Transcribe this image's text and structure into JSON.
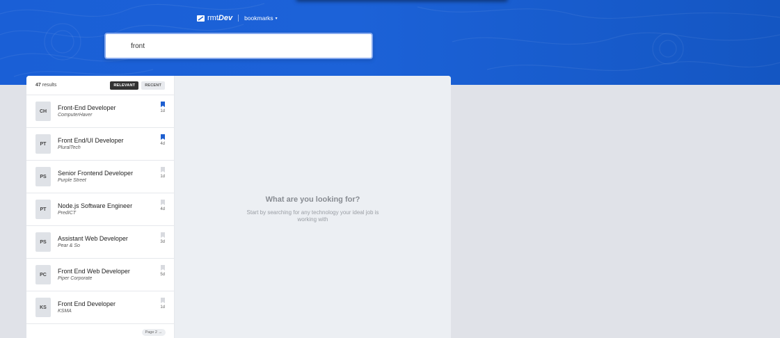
{
  "header": {
    "logo_light": "rmt",
    "logo_bold": "Dev",
    "bookmarks_label": "bookmarks",
    "bookmarks_caret": "▾"
  },
  "search": {
    "value": "front",
    "placeholder": ""
  },
  "sidebar": {
    "results_count": "47",
    "results_suffix": " results",
    "sort": [
      {
        "label": "RELEVANT",
        "active": true
      },
      {
        "label": "RECENT",
        "active": false
      }
    ],
    "jobs": [
      {
        "badge": "CH",
        "title": "Front-End Developer",
        "company": "ComputerHaver",
        "age": "1d",
        "bookmarked": true
      },
      {
        "badge": "PT",
        "title": "Front End/UI Developer",
        "company": "PluralTech",
        "age": "4d",
        "bookmarked": true
      },
      {
        "badge": "PS",
        "title": "Senior Frontend Developer",
        "company": "Purple Street",
        "age": "1d",
        "bookmarked": false
      },
      {
        "badge": "PT",
        "title": "Node.js Software Engineer",
        "company": "PredICT",
        "age": "4d",
        "bookmarked": false
      },
      {
        "badge": "PS",
        "title": "Assistant Web Developer",
        "company": "Pear & So",
        "age": "3d",
        "bookmarks": false
      },
      {
        "badge": "PC",
        "title": "Front End Web Developer",
        "company": "Piper Corporate",
        "age": "5d",
        "bookmarked": false
      },
      {
        "badge": "KS",
        "title": "Front End Developer",
        "company": "KSMA",
        "age": "1d",
        "bookmarked": false
      }
    ],
    "page_label": "Page 2 →"
  },
  "content": {
    "empty_title": "What are you looking for?",
    "empty_text": "Start by searching for any technology your ideal job is working with"
  },
  "colors": {
    "accent": "#1c62d8",
    "bookmark_active": "#1e5fd0",
    "bookmark_inactive": "#d8dadf"
  }
}
